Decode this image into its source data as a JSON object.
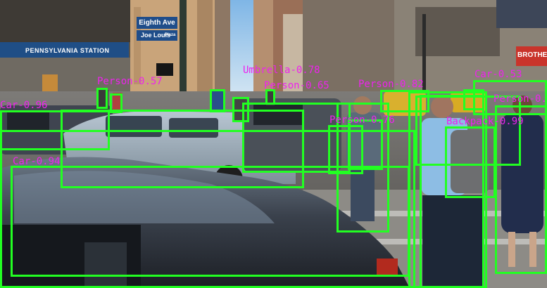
{
  "photo": {
    "signs": {
      "street_1": "Eighth Ave",
      "street_2": "Joe Louis",
      "street_2_small": "Plaza",
      "station": "PENNSYLVANIA STATION",
      "store": "BROTHER"
    }
  },
  "detections": [
    {
      "label": "Car",
      "score": "0.94"
    },
    {
      "label": "Car",
      "score": "0.96"
    },
    {
      "label": "Car",
      "score": "0.53"
    },
    {
      "label": "Person",
      "score": "0.99"
    },
    {
      "label": "Umbrella",
      "score": "0.78"
    },
    {
      "label": "Person",
      "score": "0.65"
    },
    {
      "label": "Person",
      "score": "0.76"
    },
    {
      "label": "Backpack",
      "score": "0.99"
    },
    {
      "label": "Person",
      "score": "0.82"
    },
    {
      "label": "Person",
      "score": "0.57"
    }
  ],
  "colors": {
    "box": "#22ff22",
    "label": "#ee22ee"
  }
}
